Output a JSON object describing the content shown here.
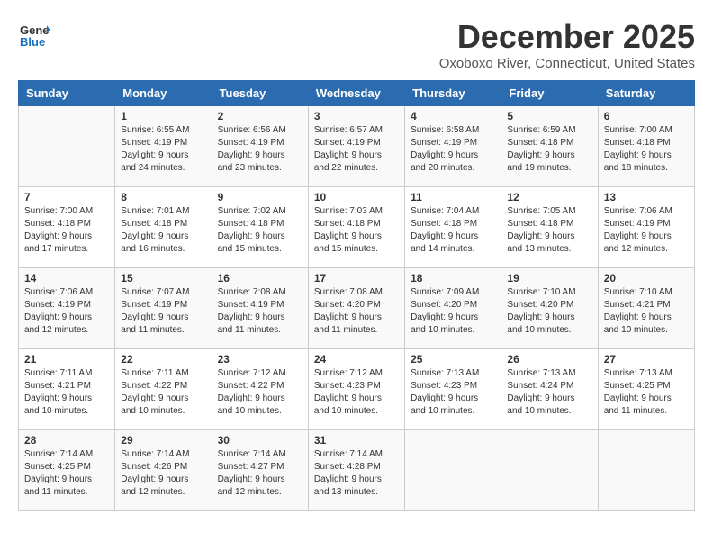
{
  "header": {
    "logo_line1": "General",
    "logo_line2": "Blue",
    "month": "December 2025",
    "location": "Oxoboxo River, Connecticut, United States"
  },
  "weekdays": [
    "Sunday",
    "Monday",
    "Tuesday",
    "Wednesday",
    "Thursday",
    "Friday",
    "Saturday"
  ],
  "weeks": [
    [
      {
        "day": "",
        "sunrise": "",
        "sunset": "",
        "daylight": ""
      },
      {
        "day": "1",
        "sunrise": "Sunrise: 6:55 AM",
        "sunset": "Sunset: 4:19 PM",
        "daylight": "Daylight: 9 hours and 24 minutes."
      },
      {
        "day": "2",
        "sunrise": "Sunrise: 6:56 AM",
        "sunset": "Sunset: 4:19 PM",
        "daylight": "Daylight: 9 hours and 23 minutes."
      },
      {
        "day": "3",
        "sunrise": "Sunrise: 6:57 AM",
        "sunset": "Sunset: 4:19 PM",
        "daylight": "Daylight: 9 hours and 22 minutes."
      },
      {
        "day": "4",
        "sunrise": "Sunrise: 6:58 AM",
        "sunset": "Sunset: 4:19 PM",
        "daylight": "Daylight: 9 hours and 20 minutes."
      },
      {
        "day": "5",
        "sunrise": "Sunrise: 6:59 AM",
        "sunset": "Sunset: 4:18 PM",
        "daylight": "Daylight: 9 hours and 19 minutes."
      },
      {
        "day": "6",
        "sunrise": "Sunrise: 7:00 AM",
        "sunset": "Sunset: 4:18 PM",
        "daylight": "Daylight: 9 hours and 18 minutes."
      }
    ],
    [
      {
        "day": "7",
        "sunrise": "Sunrise: 7:00 AM",
        "sunset": "Sunset: 4:18 PM",
        "daylight": "Daylight: 9 hours and 17 minutes."
      },
      {
        "day": "8",
        "sunrise": "Sunrise: 7:01 AM",
        "sunset": "Sunset: 4:18 PM",
        "daylight": "Daylight: 9 hours and 16 minutes."
      },
      {
        "day": "9",
        "sunrise": "Sunrise: 7:02 AM",
        "sunset": "Sunset: 4:18 PM",
        "daylight": "Daylight: 9 hours and 15 minutes."
      },
      {
        "day": "10",
        "sunrise": "Sunrise: 7:03 AM",
        "sunset": "Sunset: 4:18 PM",
        "daylight": "Daylight: 9 hours and 15 minutes."
      },
      {
        "day": "11",
        "sunrise": "Sunrise: 7:04 AM",
        "sunset": "Sunset: 4:18 PM",
        "daylight": "Daylight: 9 hours and 14 minutes."
      },
      {
        "day": "12",
        "sunrise": "Sunrise: 7:05 AM",
        "sunset": "Sunset: 4:18 PM",
        "daylight": "Daylight: 9 hours and 13 minutes."
      },
      {
        "day": "13",
        "sunrise": "Sunrise: 7:06 AM",
        "sunset": "Sunset: 4:19 PM",
        "daylight": "Daylight: 9 hours and 12 minutes."
      }
    ],
    [
      {
        "day": "14",
        "sunrise": "Sunrise: 7:06 AM",
        "sunset": "Sunset: 4:19 PM",
        "daylight": "Daylight: 9 hours and 12 minutes."
      },
      {
        "day": "15",
        "sunrise": "Sunrise: 7:07 AM",
        "sunset": "Sunset: 4:19 PM",
        "daylight": "Daylight: 9 hours and 11 minutes."
      },
      {
        "day": "16",
        "sunrise": "Sunrise: 7:08 AM",
        "sunset": "Sunset: 4:19 PM",
        "daylight": "Daylight: 9 hours and 11 minutes."
      },
      {
        "day": "17",
        "sunrise": "Sunrise: 7:08 AM",
        "sunset": "Sunset: 4:20 PM",
        "daylight": "Daylight: 9 hours and 11 minutes."
      },
      {
        "day": "18",
        "sunrise": "Sunrise: 7:09 AM",
        "sunset": "Sunset: 4:20 PM",
        "daylight": "Daylight: 9 hours and 10 minutes."
      },
      {
        "day": "19",
        "sunrise": "Sunrise: 7:10 AM",
        "sunset": "Sunset: 4:20 PM",
        "daylight": "Daylight: 9 hours and 10 minutes."
      },
      {
        "day": "20",
        "sunrise": "Sunrise: 7:10 AM",
        "sunset": "Sunset: 4:21 PM",
        "daylight": "Daylight: 9 hours and 10 minutes."
      }
    ],
    [
      {
        "day": "21",
        "sunrise": "Sunrise: 7:11 AM",
        "sunset": "Sunset: 4:21 PM",
        "daylight": "Daylight: 9 hours and 10 minutes."
      },
      {
        "day": "22",
        "sunrise": "Sunrise: 7:11 AM",
        "sunset": "Sunset: 4:22 PM",
        "daylight": "Daylight: 9 hours and 10 minutes."
      },
      {
        "day": "23",
        "sunrise": "Sunrise: 7:12 AM",
        "sunset": "Sunset: 4:22 PM",
        "daylight": "Daylight: 9 hours and 10 minutes."
      },
      {
        "day": "24",
        "sunrise": "Sunrise: 7:12 AM",
        "sunset": "Sunset: 4:23 PM",
        "daylight": "Daylight: 9 hours and 10 minutes."
      },
      {
        "day": "25",
        "sunrise": "Sunrise: 7:13 AM",
        "sunset": "Sunset: 4:23 PM",
        "daylight": "Daylight: 9 hours and 10 minutes."
      },
      {
        "day": "26",
        "sunrise": "Sunrise: 7:13 AM",
        "sunset": "Sunset: 4:24 PM",
        "daylight": "Daylight: 9 hours and 10 minutes."
      },
      {
        "day": "27",
        "sunrise": "Sunrise: 7:13 AM",
        "sunset": "Sunset: 4:25 PM",
        "daylight": "Daylight: 9 hours and 11 minutes."
      }
    ],
    [
      {
        "day": "28",
        "sunrise": "Sunrise: 7:14 AM",
        "sunset": "Sunset: 4:25 PM",
        "daylight": "Daylight: 9 hours and 11 minutes."
      },
      {
        "day": "29",
        "sunrise": "Sunrise: 7:14 AM",
        "sunset": "Sunset: 4:26 PM",
        "daylight": "Daylight: 9 hours and 12 minutes."
      },
      {
        "day": "30",
        "sunrise": "Sunrise: 7:14 AM",
        "sunset": "Sunset: 4:27 PM",
        "daylight": "Daylight: 9 hours and 12 minutes."
      },
      {
        "day": "31",
        "sunrise": "Sunrise: 7:14 AM",
        "sunset": "Sunset: 4:28 PM",
        "daylight": "Daylight: 9 hours and 13 minutes."
      },
      {
        "day": "",
        "sunrise": "",
        "sunset": "",
        "daylight": ""
      },
      {
        "day": "",
        "sunrise": "",
        "sunset": "",
        "daylight": ""
      },
      {
        "day": "",
        "sunrise": "",
        "sunset": "",
        "daylight": ""
      }
    ]
  ]
}
